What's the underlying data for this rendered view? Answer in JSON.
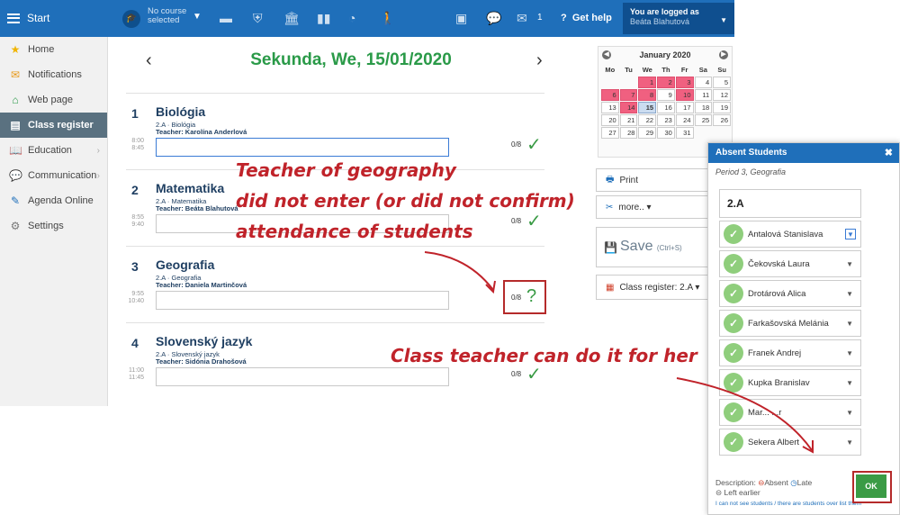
{
  "topbar": {
    "start_label": "Start",
    "course_label": "No course selected",
    "mail_count": "1",
    "help_label": "Get help",
    "logged_label": "You are logged as",
    "logged_user": "Beáta Blahutová"
  },
  "sidebar": {
    "items": [
      {
        "label": "Home",
        "icon": "star-icon"
      },
      {
        "label": "Notifications",
        "icon": "envelope-icon"
      },
      {
        "label": "Web page",
        "icon": "house-icon"
      },
      {
        "label": "Class register",
        "icon": "register-icon"
      },
      {
        "label": "Education",
        "icon": "book-icon"
      },
      {
        "label": "Communication",
        "icon": "chat-icon"
      },
      {
        "label": "Agenda Online",
        "icon": "pencil-icon"
      },
      {
        "label": "Settings",
        "icon": "gear-icon"
      }
    ]
  },
  "day_title": "Sekunda, We, 15/01/2020",
  "lessons": [
    {
      "num": "1",
      "subject": "Biológia",
      "class_line": "2.A · Biológia",
      "teacher": "Teacher:  Karolína Anderlová",
      "time_start": "8:00",
      "time_end": "8:45",
      "attendance": "0/8"
    },
    {
      "num": "2",
      "subject": "Matematika",
      "class_line": "2.A · Matematika",
      "teacher": "Teacher:  Beáta Blahutová",
      "time_start": "8:55",
      "time_end": "9:40",
      "attendance": "0/8"
    },
    {
      "num": "3",
      "subject": "Geografia",
      "class_line": "2.A · Geografia",
      "teacher": "Teacher:  Daniela Martinčová",
      "time_start": "9:55",
      "time_end": "10:40",
      "attendance": "0/8"
    },
    {
      "num": "4",
      "subject": "Slovenský jazyk",
      "class_line": "2.A · Slovenský jazyk",
      "teacher": "Teacher:  Sidónia Drahošová",
      "time_start": "11:00",
      "time_end": "11:45",
      "attendance": "0/8"
    }
  ],
  "annotations": {
    "top_line1": "Teacher of geography",
    "top_line2": "did not enter (or did not confirm)",
    "top_line3": "attendance of students",
    "bottom": "Class teacher can do it for her",
    "color": "#c0232a"
  },
  "calendar": {
    "title": "January 2020",
    "weekdays": [
      "Mo",
      "Tu",
      "We",
      "Th",
      "Fr",
      "Sa",
      "Su"
    ],
    "weeks": [
      [
        "",
        "",
        "1",
        "2",
        "3",
        "4",
        "5"
      ],
      [
        "6",
        "7",
        "8",
        "9",
        "10",
        "11",
        "12"
      ],
      [
        "13",
        "14",
        "15",
        "16",
        "17",
        "18",
        "19"
      ],
      [
        "20",
        "21",
        "22",
        "23",
        "24",
        "25",
        "26"
      ],
      [
        "27",
        "28",
        "29",
        "30",
        "31",
        "",
        ""
      ]
    ],
    "holidays": [
      "1",
      "2",
      "3",
      "6",
      "7",
      "8",
      "10",
      "14"
    ],
    "today": "15"
  },
  "actions": {
    "print": "Print",
    "more": "more.. ▾",
    "save": "Save",
    "save_hint": "(Ctrl+S)",
    "class_register": "Class register: 2.A ▾"
  },
  "absent_panel": {
    "title": "Absent Students",
    "period": "Period 3, Geografia",
    "class": "2.A",
    "students": [
      "Antalová Stanislava",
      "Čekovská Laura",
      "Drotárová Alica",
      "Farkašovská Melánia",
      "Franek Andrej",
      "Kupka Branislav",
      "Mar... ...r",
      "Sekera Albert"
    ],
    "description_label": "Description:",
    "absent": "Absent",
    "late": "Late",
    "left_earlier": "Left earlier",
    "link": "I can not see students / there are students over list them",
    "ok": "OK"
  }
}
